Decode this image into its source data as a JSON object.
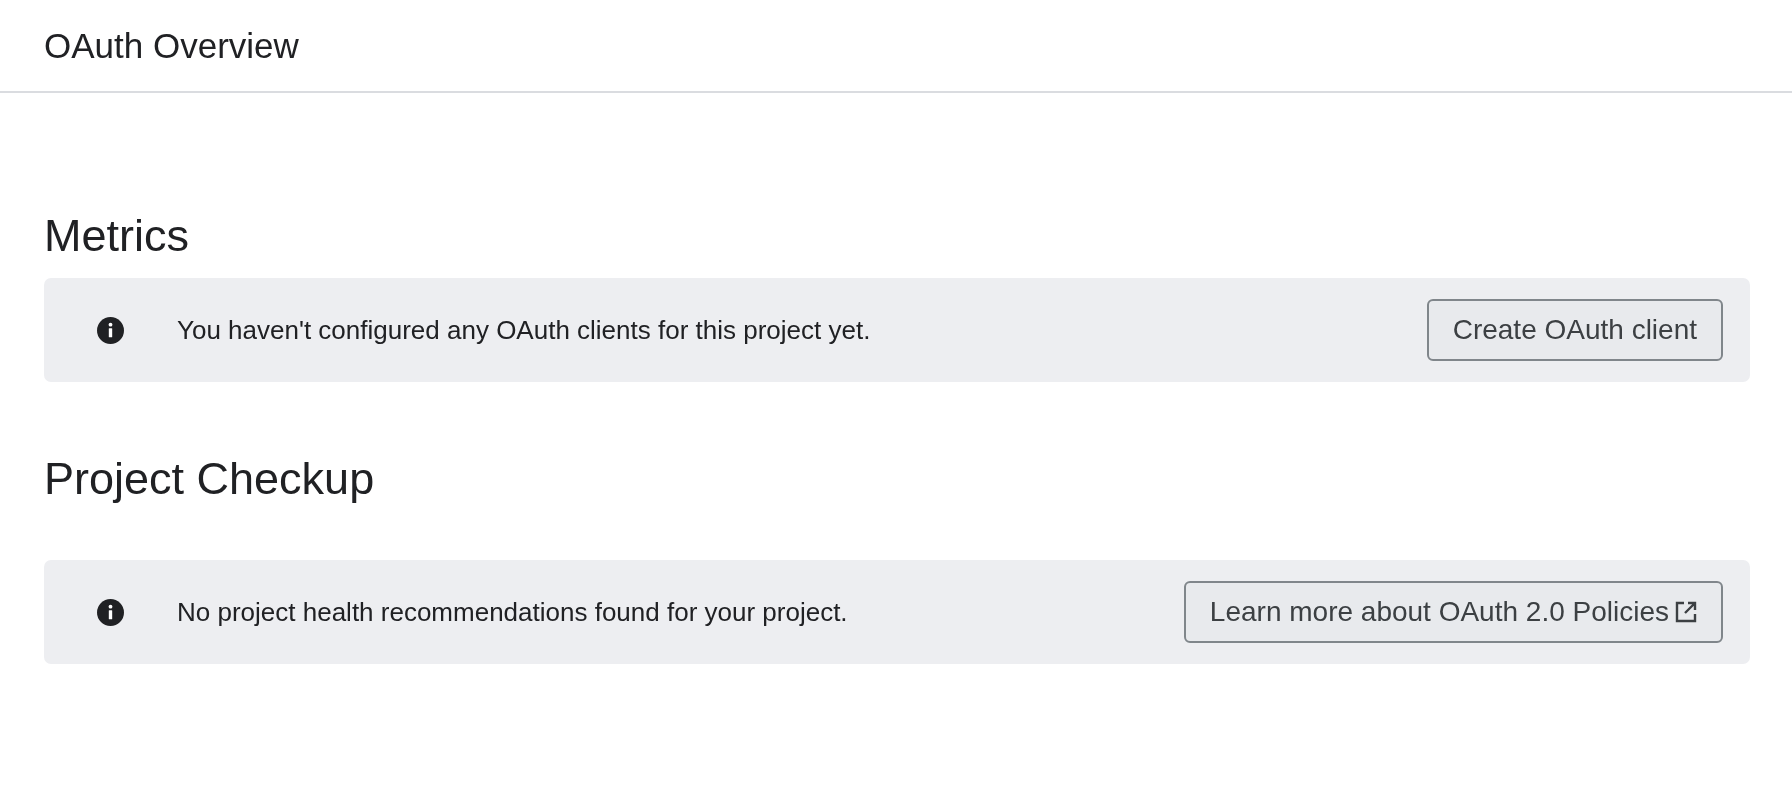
{
  "header": {
    "title": "OAuth Overview"
  },
  "sections": [
    {
      "heading": "Metrics",
      "banner": {
        "message": "You haven't configured any OAuth clients for this project yet.",
        "button": {
          "label": "Create OAuth client",
          "external": false
        }
      }
    },
    {
      "heading": "Project Checkup",
      "banner": {
        "message": "No project health recommendations found for your project.",
        "button": {
          "label": "Learn more about OAuth 2.0 Policies",
          "external": true
        }
      }
    }
  ]
}
